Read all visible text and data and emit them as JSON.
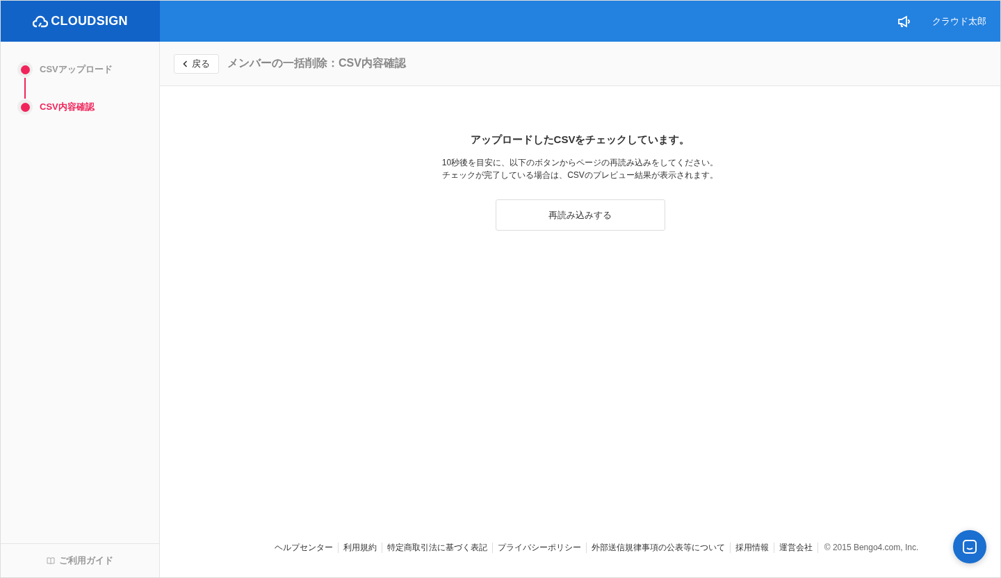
{
  "header": {
    "logo": "CLOUDSIGN",
    "user": "クラウド太郎"
  },
  "sidebar": {
    "steps": [
      {
        "label": "CSVアップロード",
        "selected": false
      },
      {
        "label": "CSV内容確認",
        "selected": true
      }
    ],
    "guide": "ご利用ガイド"
  },
  "toolbar": {
    "back": "戻る",
    "title": "メンバーの一括削除：CSV内容確認"
  },
  "message": {
    "heading": "アップロードしたCSVをチェックしています。",
    "lines": [
      "10秒後を目安に、以下のボタンからページの再読み込みをしてください。",
      "チェックが完了している場合は、CSVのプレビュー結果が表示されます。"
    ],
    "button": "再読み込みする"
  },
  "footer": {
    "links": [
      "ヘルプセンター",
      "利用規約",
      "特定商取引法に基づく表記",
      "プライバシーポリシー",
      "外部送信規律事項の公表等について",
      "採用情報",
      "運営会社"
    ],
    "copyright": "© 2015 Bengo4.com, Inc."
  }
}
